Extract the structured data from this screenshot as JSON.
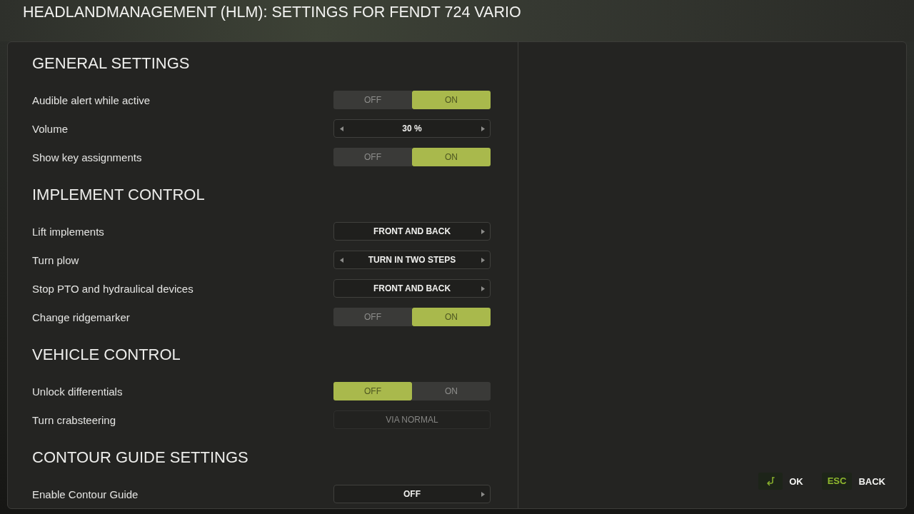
{
  "window": {
    "title": "HEADLANDMANAGEMENT (HLM): SETTINGS FOR FENDT 724 VARIO"
  },
  "sections": [
    {
      "title": "GENERAL SETTINGS",
      "settings": [
        {
          "label": "Audible alert while active",
          "kind": "toggle",
          "options": [
            {
              "label": "OFF",
              "selected": false
            },
            {
              "label": "ON",
              "selected": true
            }
          ]
        },
        {
          "label": "Volume",
          "kind": "selector",
          "value": "30 %",
          "prev_arrow": true,
          "next_arrow": true,
          "disabled": false
        },
        {
          "label": "Show key assignments",
          "kind": "toggle",
          "options": [
            {
              "label": "OFF",
              "selected": false
            },
            {
              "label": "ON",
              "selected": true
            }
          ]
        }
      ]
    },
    {
      "title": "IMPLEMENT CONTROL",
      "settings": [
        {
          "label": "Lift implements",
          "kind": "selector",
          "value": "FRONT AND BACK",
          "prev_arrow": false,
          "next_arrow": true,
          "disabled": false
        },
        {
          "label": "Turn plow",
          "kind": "selector",
          "value": "TURN IN TWO STEPS",
          "prev_arrow": true,
          "next_arrow": true,
          "disabled": false
        },
        {
          "label": "Stop PTO and hydraulical devices",
          "kind": "selector",
          "value": "FRONT AND BACK",
          "prev_arrow": false,
          "next_arrow": true,
          "disabled": false
        },
        {
          "label": "Change ridgemarker",
          "kind": "toggle",
          "options": [
            {
              "label": "OFF",
              "selected": false
            },
            {
              "label": "ON",
              "selected": true
            }
          ]
        }
      ]
    },
    {
      "title": "VEHICLE CONTROL",
      "settings": [
        {
          "label": "Unlock differentials",
          "kind": "toggle",
          "options": [
            {
              "label": "OFF",
              "selected": true
            },
            {
              "label": "ON",
              "selected": false
            }
          ]
        },
        {
          "label": "Turn crabsteering",
          "kind": "selector",
          "value": "VIA NORMAL",
          "prev_arrow": false,
          "next_arrow": false,
          "disabled": true
        }
      ]
    },
    {
      "title": "CONTOUR GUIDE SETTINGS",
      "settings": [
        {
          "label": "Enable Contour Guide",
          "kind": "selector",
          "value": "OFF",
          "prev_arrow": false,
          "next_arrow": true,
          "disabled": false
        }
      ]
    }
  ],
  "footer_buttons": [
    {
      "kind": "icon",
      "label": "OK"
    },
    {
      "kind": "key",
      "key": "ESC",
      "label": "BACK"
    }
  ]
}
